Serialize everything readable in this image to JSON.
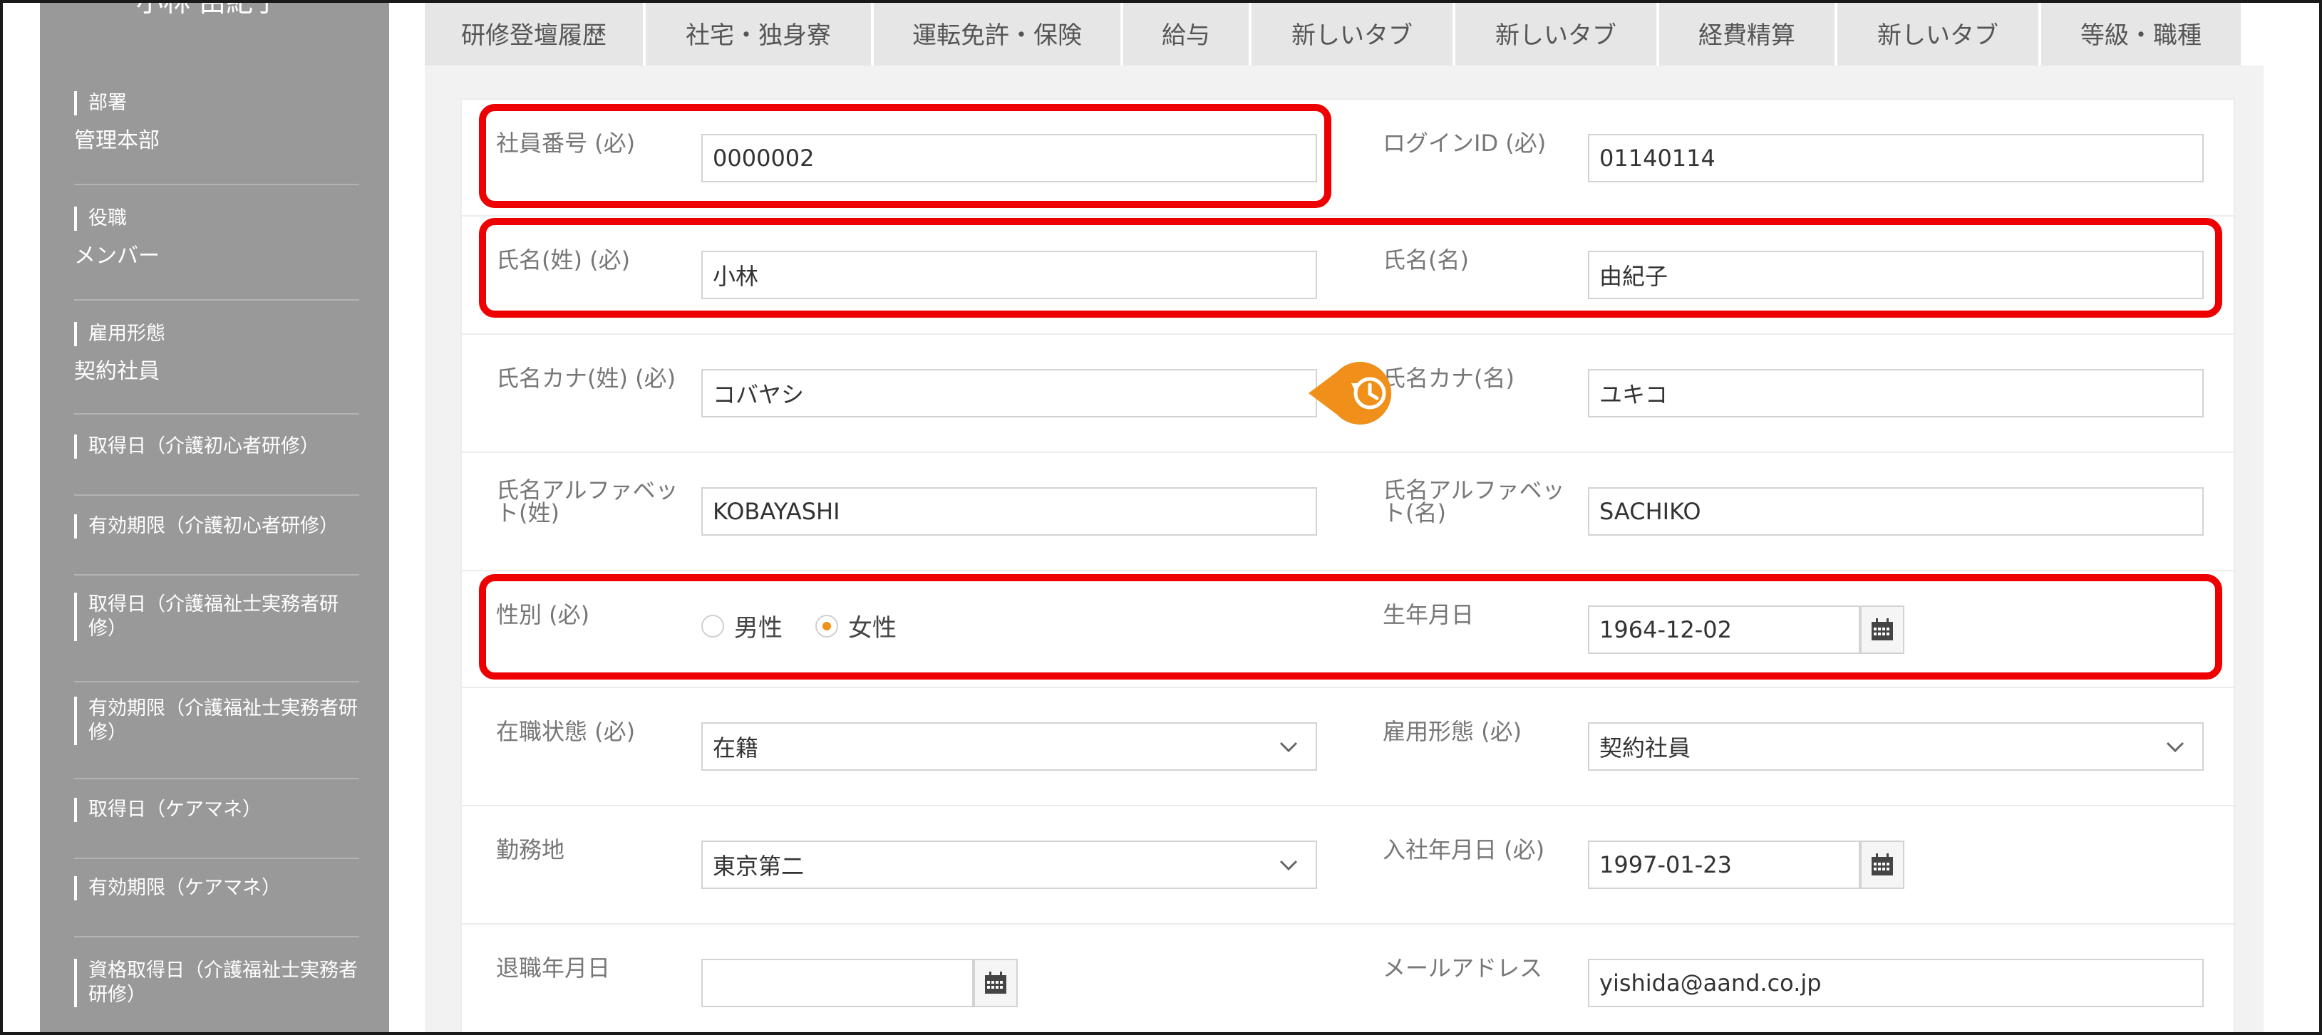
{
  "sidebar": {
    "username": "小林 由紀子",
    "items": [
      {
        "label": "部署",
        "value": "管理本部"
      },
      {
        "label": "役職",
        "value": "メンバー"
      },
      {
        "label": "雇用形態",
        "value": "契約社員"
      },
      {
        "label": "取得日（介護初心者研修）",
        "value": ""
      },
      {
        "label": "有効期限（介護初心者研修）",
        "value": ""
      },
      {
        "label": "取得日（介護福祉士実務者研修）",
        "value": ""
      },
      {
        "label": "有効期限（介護福祉士実務者研修）",
        "value": ""
      },
      {
        "label": "取得日（ケアマネ）",
        "value": ""
      },
      {
        "label": "有効期限（ケアマネ）",
        "value": ""
      },
      {
        "label": "資格取得日（介護福祉士実務者研修）",
        "value": ""
      }
    ]
  },
  "tabs": [
    "研修登壇履歴",
    "社宅・独身寮",
    "運転免許・保険",
    "給与",
    "新しいタブ",
    "新しいタブ",
    "経費精算",
    "新しいタブ",
    "等級・職種"
  ],
  "form": {
    "employee_no": {
      "label": "社員番号 (必)",
      "value": "0000002"
    },
    "login_id": {
      "label": "ログインID (必)",
      "value": "01140114"
    },
    "last_name": {
      "label": "氏名(姓) (必)",
      "value": "小林"
    },
    "first_name": {
      "label": "氏名(名)",
      "value": "由紀子"
    },
    "last_kana": {
      "label": "氏名カナ(姓) (必)",
      "value": "コバヤシ"
    },
    "first_kana": {
      "label": "氏名カナ(名)",
      "value": "ユキコ"
    },
    "last_alpha": {
      "label": "氏名アルファベット(姓)",
      "value": "KOBAYASHI"
    },
    "first_alpha": {
      "label": "氏名アルファベット(名)",
      "value": "SACHIKO"
    },
    "gender": {
      "label": "性別 (必)",
      "options": [
        "男性",
        "女性"
      ],
      "selected": "女性"
    },
    "birthdate": {
      "label": "生年月日",
      "value": "1964-12-02"
    },
    "status": {
      "label": "在職状態 (必)",
      "value": "在籍"
    },
    "employment_type": {
      "label": "雇用形態 (必)",
      "value": "契約社員"
    },
    "workplace": {
      "label": "勤務地",
      "value": "東京第二"
    },
    "join_date": {
      "label": "入社年月日 (必)",
      "value": "1997-01-23"
    },
    "retire_date": {
      "label": "退職年月日",
      "value": ""
    },
    "email": {
      "label": "メールアドレス",
      "value": "yishida@aand.co.jp"
    }
  },
  "colors": {
    "sidebar": "#999999",
    "accent": "#f0901a",
    "highlight": "#ee0000",
    "tab": "#e6e6e6"
  },
  "icons": {
    "history": "history-icon",
    "calendar": "calendar-icon",
    "chevron": "chevron-down-icon"
  }
}
